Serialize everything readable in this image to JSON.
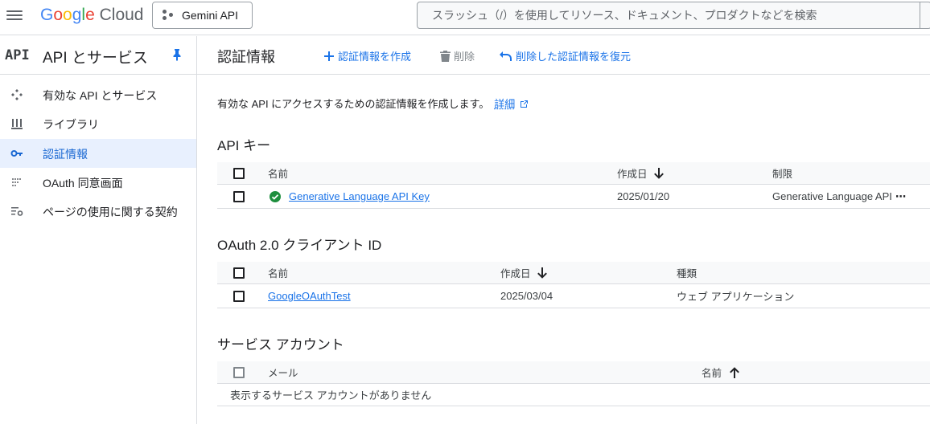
{
  "topbar": {
    "logo_google": [
      "G",
      "o",
      "o",
      "g",
      "l",
      "e"
    ],
    "logo_cloud": "Cloud",
    "project_label": "Gemini API",
    "search_placeholder": "スラッシュ（/）を使用してリソース、ドキュメント、プロダクトなどを検索"
  },
  "nav": {
    "badge": "API",
    "title": "API とサービス",
    "items": [
      {
        "label": "有効な API とサービス",
        "icon": "api-services-icon",
        "active": false
      },
      {
        "label": "ライブラリ",
        "icon": "library-icon",
        "active": false
      },
      {
        "label": "認証情報",
        "icon": "key-icon",
        "active": true
      },
      {
        "label": "OAuth 同意画面",
        "icon": "consent-icon",
        "active": false
      },
      {
        "label": "ページの使用に関する契約",
        "icon": "settings-list-icon",
        "active": false
      }
    ]
  },
  "page": {
    "title": "認証情報",
    "create_label": "認証情報を作成",
    "delete_label": "削除",
    "restore_label": "削除した認証情報を復元",
    "intro_text": "有効な API にアクセスするための認証情報を作成します。",
    "intro_link": "詳細"
  },
  "api_keys": {
    "title": "API キー",
    "col_name": "名前",
    "col_created": "作成日",
    "col_restriction": "制限",
    "rows": [
      {
        "name": "Generative Language API Key",
        "created": "2025/01/20",
        "restriction": "Generative Language API",
        "more": "⋯"
      }
    ]
  },
  "oauth": {
    "title": "OAuth 2.0 クライアント ID",
    "col_name": "名前",
    "col_created": "作成日",
    "col_type": "種類",
    "rows": [
      {
        "name": "GoogleOAuthTest",
        "created": "2025/03/04",
        "type": "ウェブ アプリケーション"
      }
    ]
  },
  "service_accounts": {
    "title": "サービス アカウント",
    "col_email": "メール",
    "col_name": "名前",
    "empty": "表示するサービス アカウントがありません"
  },
  "colors": {
    "accent": "#1a73e8",
    "active_bg": "#e8f0fe",
    "border": "#dadce0",
    "success": "#1e8e3e"
  }
}
